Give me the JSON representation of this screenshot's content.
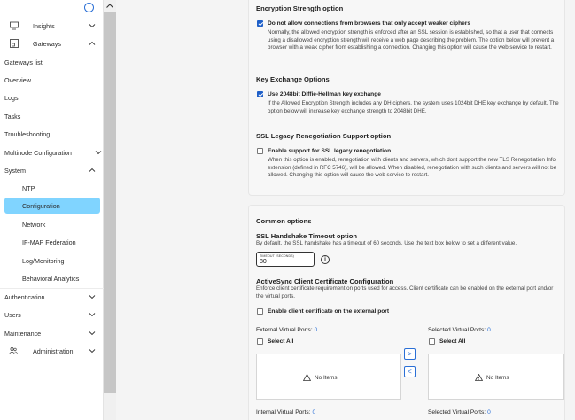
{
  "sidebar": {
    "items": [
      {
        "label": "Insights"
      },
      {
        "label": "Gateways"
      },
      {
        "label": "Gateways list"
      },
      {
        "label": "Overview"
      },
      {
        "label": "Logs"
      },
      {
        "label": "Tasks"
      },
      {
        "label": "Troubleshooting"
      },
      {
        "label": "Multinode Configuration"
      },
      {
        "label": "System"
      },
      {
        "label": "NTP"
      },
      {
        "label": "Configuration"
      },
      {
        "label": "Network"
      },
      {
        "label": "IF-MAP Federation"
      },
      {
        "label": "Log/Monitoring"
      },
      {
        "label": "Behavioral Analytics"
      },
      {
        "label": "Authentication"
      },
      {
        "label": "Users"
      },
      {
        "label": "Maintenance"
      },
      {
        "label": "Administration"
      }
    ]
  },
  "encryption": {
    "title": "Encryption Strength option",
    "checkbox_label": "Do not allow connections from browsers that only accept weaker ciphers",
    "checked": true,
    "description": "Normally, the allowed encryption strength is enforced after an SSL session is established, so that a user that connects using a disallowed encryption strength will receive a web page describing the problem. The option below will prevent a browser with a weak cipher from establishing a connection. Changing this option will cause the web service to restart."
  },
  "key_exchange": {
    "title": "Key Exchange Options",
    "checkbox_label": "Use 2048bit Diffie-Hellman key exchange",
    "checked": true,
    "description": "If the Allowed Encryption Strength includes any DH ciphers, the system uses 1024bit DHE key exchange by default. The option below will increase key exchange strength to 2048bit DHE."
  },
  "ssl_legacy": {
    "title": "SSL Legacy Renegotiation Support option",
    "checkbox_label": "Enable support for SSL legacy renegotiation",
    "checked": false,
    "description": "When this option is enabled, renegotiation with clients and servers, which dont support the new TLS Renegotiation Info extension (defined in RFC 5746), will be allowed. When disabled, renegotiation with such clients and servers will not be allowed. Changing this option will cause the web service to restart."
  },
  "common": {
    "title": "Common options",
    "handshake": {
      "title": "SSL Handshake Timeout option",
      "description": "By default, the SSL handshake has a timeout of 60 seconds. Use the text box below to set a different value.",
      "input_label": "TIMEOUT (SECONDS)",
      "input_value": "80"
    },
    "activesync": {
      "title": "ActiveSync Client Certificate Configuration",
      "description": "Enforce client certificate requirement on ports used for access. Client certificate can be enabled on the external port and/or the virtual ports.",
      "checkbox_label": "Enable client certificate on the external port",
      "checked": false
    },
    "external_ports_label": "External Virtual Ports:",
    "external_ports_count": "0",
    "selected_ports_label": "Selected Virtual Ports:",
    "selected_ports_count": "0",
    "internal_ports_label": "Internal Virtual Ports:",
    "internal_ports_count": "0",
    "selected_ports2_label": "Selected Virtual Ports:",
    "selected_ports2_count": "0",
    "select_all": "Select All",
    "no_items": "No Items",
    "move_right": ">",
    "move_left": "<"
  }
}
